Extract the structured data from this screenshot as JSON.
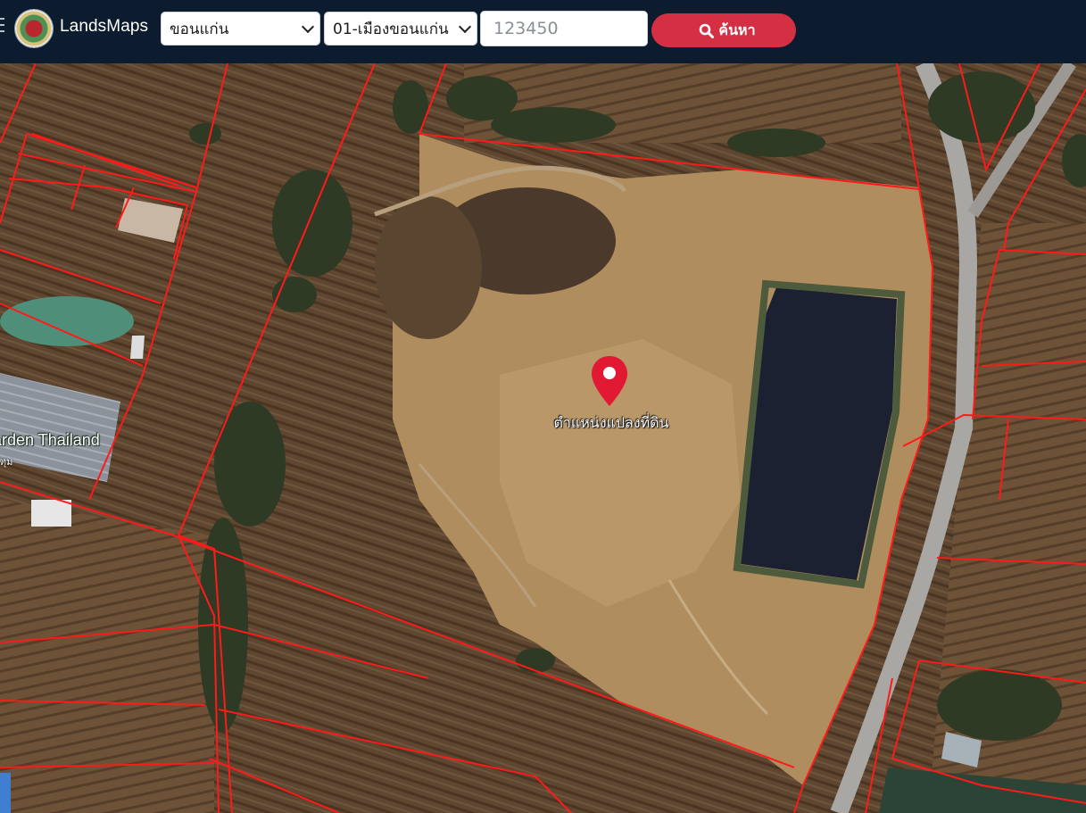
{
  "header": {
    "brand": "LandsMaps",
    "province_select": "ขอนแก่น",
    "district_select": "01-เมืองขอนแก่น",
    "parcel_placeholder": "123450",
    "search_label": "ค้นหา",
    "colors": {
      "bar": "#0d1b2e",
      "button": "#d52f43"
    }
  },
  "map": {
    "poi_label": "arden Thailand",
    "poi_sub": "ฑุม",
    "pin_label": "ตำแหน่งแปลงที่ดิน",
    "parcel_line_color": "#ff1a1a",
    "pin_color": "#e11932",
    "icons": [
      "menu-icon",
      "search-icon",
      "location-pin-icon",
      "logo-emblem"
    ]
  }
}
